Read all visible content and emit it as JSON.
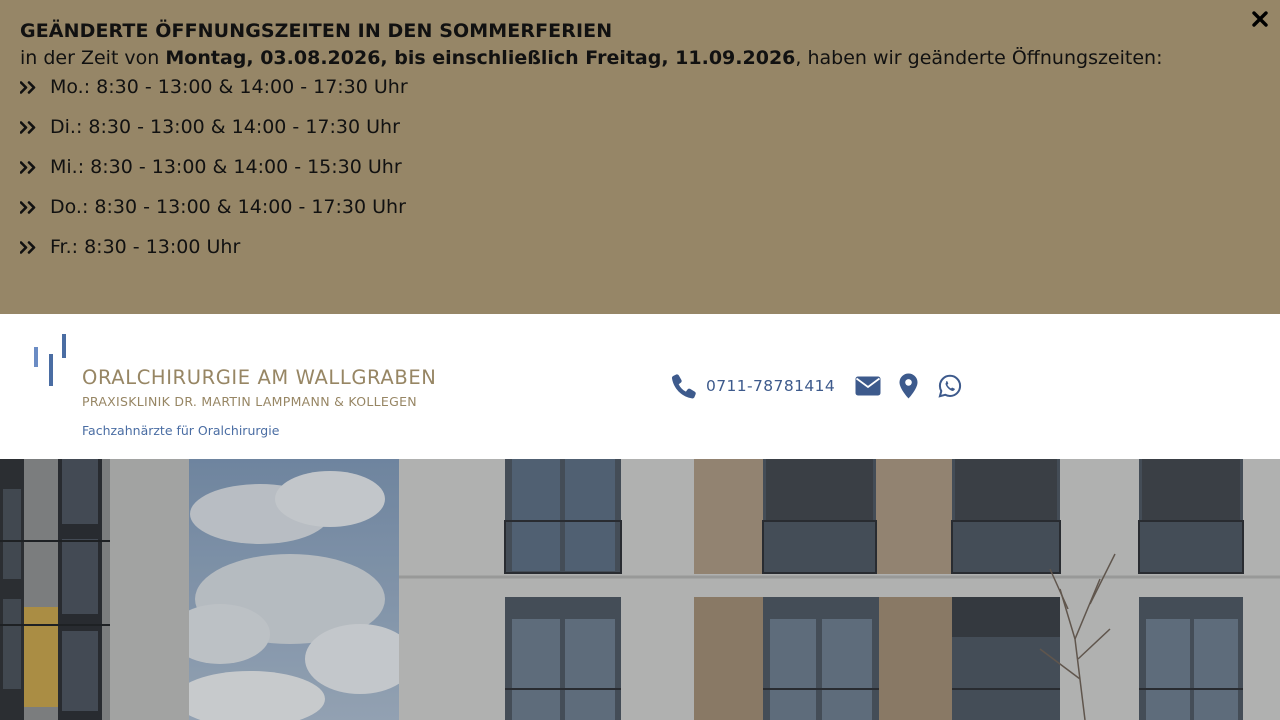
{
  "notice": {
    "title": "GEÄNDERTE ÖFFNUNGSZEITEN IN DEN SOMMERFERIEN",
    "intro_prefix": "in der Zeit von ",
    "intro_dates": "Montag, 03.08.2026, bis einschließlich Freitag, 11.09.2026",
    "intro_suffix": ", haben wir geänderte Öffnungszeiten:",
    "hours": [
      "Mo.: 8:30 - 13:00 & 14:00 - 17:30 Uhr",
      "Di.: 8:30 - 13:00 & 14:00 - 17:30 Uhr",
      "Mi.: 8:30 - 13:00 & 14:00 - 15:30 Uhr",
      "Do.: 8:30 - 13:00 & 14:00 - 17:30 Uhr",
      "Fr.: 8:30 - 13:00 Uhr"
    ],
    "background_color": "#968667",
    "close_icon": "close-icon"
  },
  "header": {
    "logo": {
      "name": "ORALCHIRURGIE AM WALLGRABEN",
      "subtitle": "PRAXISKLINIK DR. MARTIN LAMPMANN & KOLLEGEN",
      "tagline": "Fachzahnärzte für Oralchirurgie",
      "gold_color": "#978664",
      "blue_color": "#4a6da3"
    },
    "contact": {
      "phone": "0711-78781414",
      "icons": [
        "phone-icon",
        "envelope-icon",
        "map-marker-icon",
        "whatsapp-icon"
      ],
      "color": "#3d5a8c"
    }
  },
  "hero": {
    "image": "building-facade-photo"
  }
}
